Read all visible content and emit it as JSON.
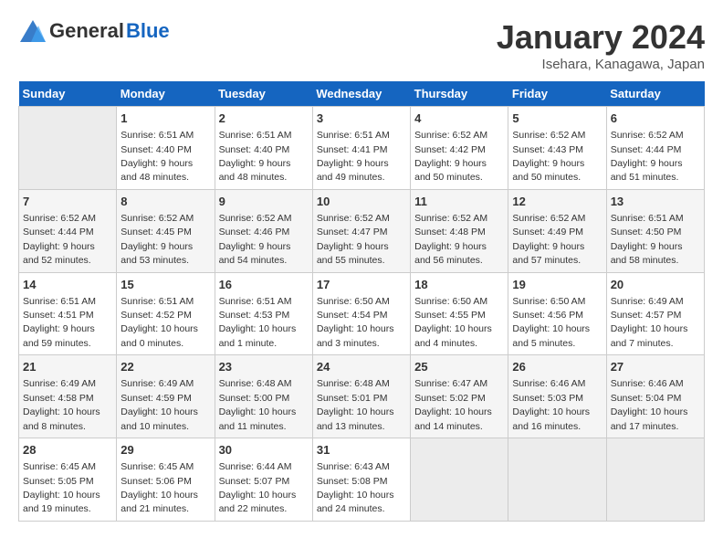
{
  "header": {
    "logo_general": "General",
    "logo_blue": "Blue",
    "title": "January 2024",
    "subtitle": "Isehara, Kanagawa, Japan"
  },
  "weekdays": [
    "Sunday",
    "Monday",
    "Tuesday",
    "Wednesday",
    "Thursday",
    "Friday",
    "Saturday"
  ],
  "weeks": [
    [
      {
        "num": "",
        "empty": true
      },
      {
        "num": "1",
        "sunrise": "6:51 AM",
        "sunset": "4:40 PM",
        "daylight": "9 hours and 48 minutes."
      },
      {
        "num": "2",
        "sunrise": "6:51 AM",
        "sunset": "4:40 PM",
        "daylight": "9 hours and 48 minutes."
      },
      {
        "num": "3",
        "sunrise": "6:51 AM",
        "sunset": "4:41 PM",
        "daylight": "9 hours and 49 minutes."
      },
      {
        "num": "4",
        "sunrise": "6:52 AM",
        "sunset": "4:42 PM",
        "daylight": "9 hours and 50 minutes."
      },
      {
        "num": "5",
        "sunrise": "6:52 AM",
        "sunset": "4:43 PM",
        "daylight": "9 hours and 50 minutes."
      },
      {
        "num": "6",
        "sunrise": "6:52 AM",
        "sunset": "4:44 PM",
        "daylight": "9 hours and 51 minutes."
      }
    ],
    [
      {
        "num": "7",
        "sunrise": "6:52 AM",
        "sunset": "4:44 PM",
        "daylight": "9 hours and 52 minutes."
      },
      {
        "num": "8",
        "sunrise": "6:52 AM",
        "sunset": "4:45 PM",
        "daylight": "9 hours and 53 minutes."
      },
      {
        "num": "9",
        "sunrise": "6:52 AM",
        "sunset": "4:46 PM",
        "daylight": "9 hours and 54 minutes."
      },
      {
        "num": "10",
        "sunrise": "6:52 AM",
        "sunset": "4:47 PM",
        "daylight": "9 hours and 55 minutes."
      },
      {
        "num": "11",
        "sunrise": "6:52 AM",
        "sunset": "4:48 PM",
        "daylight": "9 hours and 56 minutes."
      },
      {
        "num": "12",
        "sunrise": "6:52 AM",
        "sunset": "4:49 PM",
        "daylight": "9 hours and 57 minutes."
      },
      {
        "num": "13",
        "sunrise": "6:51 AM",
        "sunset": "4:50 PM",
        "daylight": "9 hours and 58 minutes."
      }
    ],
    [
      {
        "num": "14",
        "sunrise": "6:51 AM",
        "sunset": "4:51 PM",
        "daylight": "9 hours and 59 minutes."
      },
      {
        "num": "15",
        "sunrise": "6:51 AM",
        "sunset": "4:52 PM",
        "daylight": "10 hours and 0 minutes."
      },
      {
        "num": "16",
        "sunrise": "6:51 AM",
        "sunset": "4:53 PM",
        "daylight": "10 hours and 1 minute."
      },
      {
        "num": "17",
        "sunrise": "6:50 AM",
        "sunset": "4:54 PM",
        "daylight": "10 hours and 3 minutes."
      },
      {
        "num": "18",
        "sunrise": "6:50 AM",
        "sunset": "4:55 PM",
        "daylight": "10 hours and 4 minutes."
      },
      {
        "num": "19",
        "sunrise": "6:50 AM",
        "sunset": "4:56 PM",
        "daylight": "10 hours and 5 minutes."
      },
      {
        "num": "20",
        "sunrise": "6:49 AM",
        "sunset": "4:57 PM",
        "daylight": "10 hours and 7 minutes."
      }
    ],
    [
      {
        "num": "21",
        "sunrise": "6:49 AM",
        "sunset": "4:58 PM",
        "daylight": "10 hours and 8 minutes."
      },
      {
        "num": "22",
        "sunrise": "6:49 AM",
        "sunset": "4:59 PM",
        "daylight": "10 hours and 10 minutes."
      },
      {
        "num": "23",
        "sunrise": "6:48 AM",
        "sunset": "5:00 PM",
        "daylight": "10 hours and 11 minutes."
      },
      {
        "num": "24",
        "sunrise": "6:48 AM",
        "sunset": "5:01 PM",
        "daylight": "10 hours and 13 minutes."
      },
      {
        "num": "25",
        "sunrise": "6:47 AM",
        "sunset": "5:02 PM",
        "daylight": "10 hours and 14 minutes."
      },
      {
        "num": "26",
        "sunrise": "6:46 AM",
        "sunset": "5:03 PM",
        "daylight": "10 hours and 16 minutes."
      },
      {
        "num": "27",
        "sunrise": "6:46 AM",
        "sunset": "5:04 PM",
        "daylight": "10 hours and 17 minutes."
      }
    ],
    [
      {
        "num": "28",
        "sunrise": "6:45 AM",
        "sunset": "5:05 PM",
        "daylight": "10 hours and 19 minutes."
      },
      {
        "num": "29",
        "sunrise": "6:45 AM",
        "sunset": "5:06 PM",
        "daylight": "10 hours and 21 minutes."
      },
      {
        "num": "30",
        "sunrise": "6:44 AM",
        "sunset": "5:07 PM",
        "daylight": "10 hours and 22 minutes."
      },
      {
        "num": "31",
        "sunrise": "6:43 AM",
        "sunset": "5:08 PM",
        "daylight": "10 hours and 24 minutes."
      },
      {
        "num": "",
        "empty": true
      },
      {
        "num": "",
        "empty": true
      },
      {
        "num": "",
        "empty": true
      }
    ]
  ]
}
